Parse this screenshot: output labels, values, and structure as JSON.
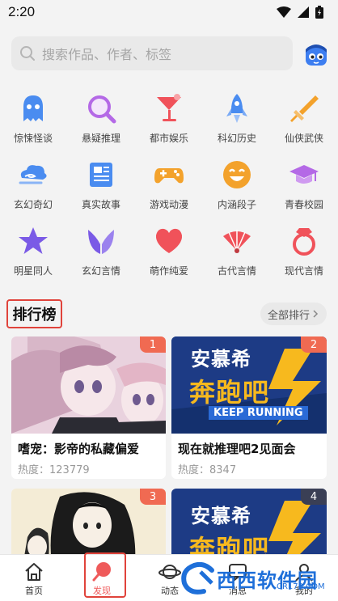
{
  "status_bar": {
    "time": "2:20",
    "icons": [
      "wifi-icon",
      "signal-icon",
      "battery-icon"
    ]
  },
  "search": {
    "placeholder": "搜索作品、作者、标签",
    "icon": "search-icon"
  },
  "categories": [
    {
      "label": "惊悚怪谈",
      "icon": "ghost-icon",
      "color": "#4a8cf0"
    },
    {
      "label": "悬疑推理",
      "icon": "magnifier-icon",
      "color": "#b469e6"
    },
    {
      "label": "都市娱乐",
      "icon": "cocktail-icon",
      "color": "#f0525a"
    },
    {
      "label": "科幻历史",
      "icon": "rocket-icon",
      "color": "#4a8cf0"
    },
    {
      "label": "仙侠武侠",
      "icon": "sword-icon",
      "color": "#f3a22c"
    },
    {
      "label": "玄幻奇幻",
      "icon": "cloud-icon",
      "color": "#4a8cf0"
    },
    {
      "label": "真实故事",
      "icon": "newspaper-icon",
      "color": "#4a8cf0"
    },
    {
      "label": "游戏动漫",
      "icon": "gamepad-icon",
      "color": "#f3a22c"
    },
    {
      "label": "内涵段子",
      "icon": "smiley-icon",
      "color": "#f3a22c"
    },
    {
      "label": "青春校园",
      "icon": "graduation-cap-icon",
      "color": "#b469e6"
    },
    {
      "label": "明星同人",
      "icon": "star-icon",
      "color": "#7a5ae6"
    },
    {
      "label": "玄幻言情",
      "icon": "wings-icon",
      "color": "#7a5ae6"
    },
    {
      "label": "萌作纯爱",
      "icon": "heart-icon",
      "color": "#f0525a"
    },
    {
      "label": "古代言情",
      "icon": "fan-icon",
      "color": "#f0525a"
    },
    {
      "label": "现代言情",
      "icon": "ring-icon",
      "color": "#f0525a"
    }
  ],
  "ranking": {
    "title": "排行榜",
    "all_label": "全部排行",
    "items": [
      {
        "rank": "1",
        "title": "嗜宠：影帝的私藏偏爱",
        "heat": "热度：123779"
      },
      {
        "rank": "2",
        "title": "现在就推理吧2见面会",
        "heat": "热度：8347",
        "cover_text": "安慕希",
        "cover_text2": "奔跑吧",
        "cover_text3": "KEEP RUNNING"
      },
      {
        "rank": "3"
      },
      {
        "rank": "4",
        "cover_text": "安慕希",
        "cover_text2": "奔跑吧"
      }
    ]
  },
  "tabbar": {
    "tabs": [
      {
        "label": "首页",
        "icon": "home-icon"
      },
      {
        "label": "发现",
        "icon": "discover-icon",
        "active": true
      },
      {
        "label": "动态",
        "icon": "planet-icon"
      },
      {
        "label": "消息",
        "icon": "message-icon"
      },
      {
        "label": "我的",
        "icon": "profile-icon"
      }
    ]
  },
  "watermark": {
    "text": "西西软件园",
    "sub": "CR173.COM"
  },
  "colors": {
    "accent": "#ef5a5a",
    "highlight_border": "#e0433b",
    "background": "#f3f3f3",
    "rank_badge": "#f06a52"
  }
}
